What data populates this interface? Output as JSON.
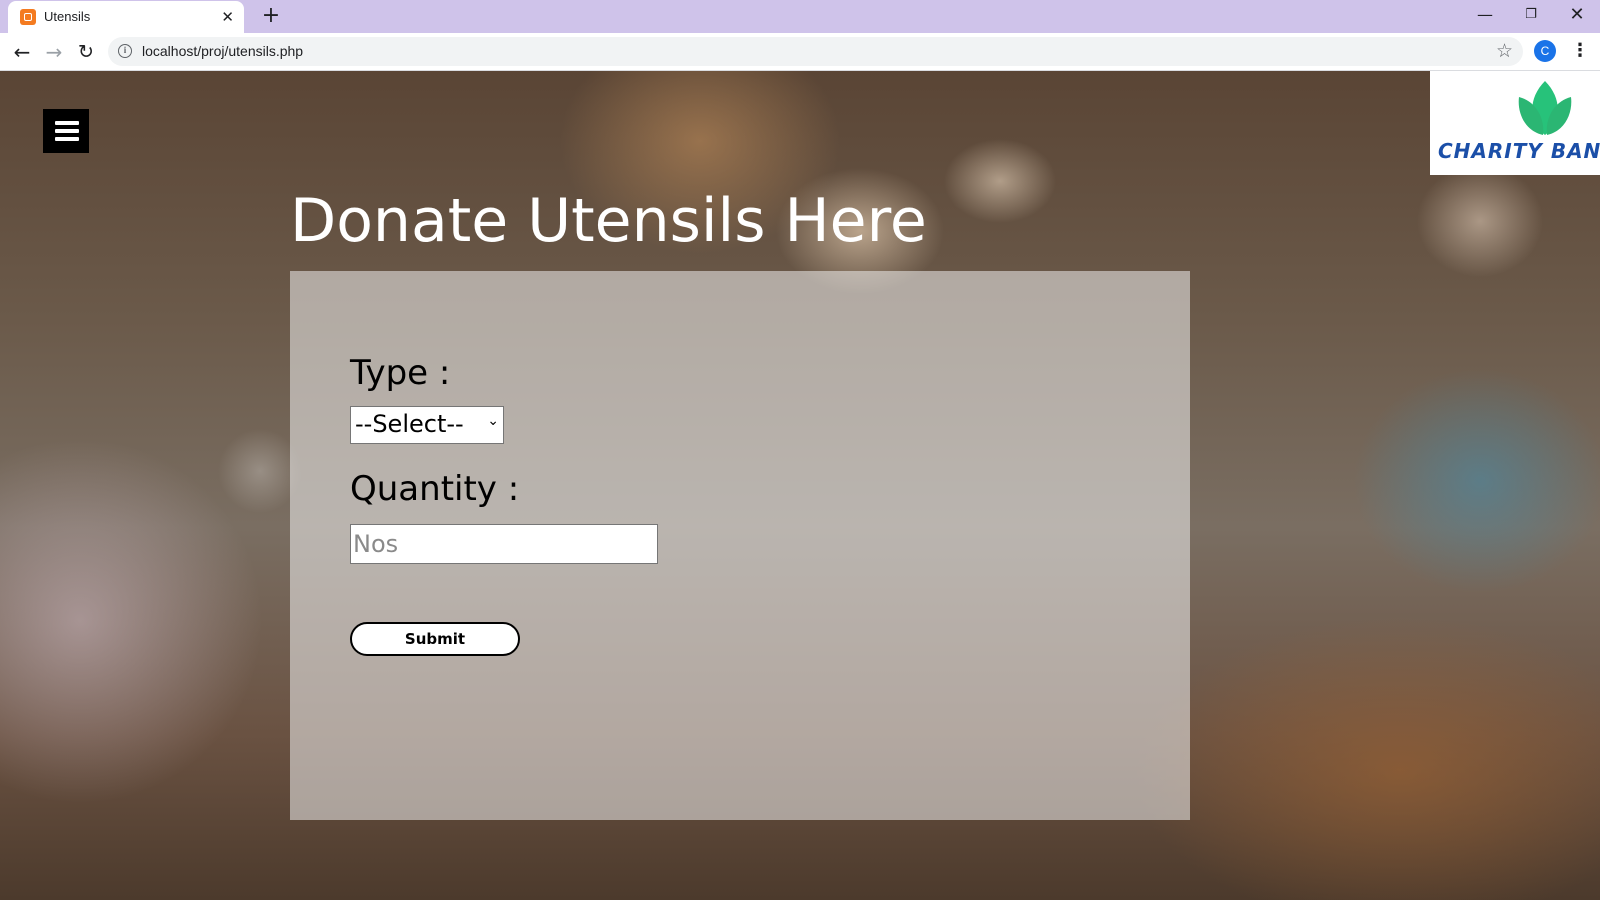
{
  "browser": {
    "tab_title": "Utensils",
    "tab_close": "✕",
    "new_tab": "+",
    "url": "localhost/proj/utensils.php",
    "profile_initial": "C",
    "window_controls": {
      "minimize": "—",
      "maximize": "❐",
      "close": "✕"
    },
    "icons": {
      "back": "arrow-left",
      "forward": "arrow-right",
      "reload": "reload",
      "info": "info",
      "star": "star",
      "menu": "kebab"
    }
  },
  "page": {
    "menu_icon": "hamburger",
    "logo_text": "CHARITY BANK",
    "heading": "Donate Utensils Here",
    "form": {
      "type_label": "Type :",
      "type_selected": "--Select--",
      "quantity_label": "Quantity :",
      "quantity_value": "",
      "quantity_placeholder": "Nos",
      "submit_label": "Submit"
    }
  },
  "colors": {
    "tabbar": "#cfc3ea",
    "logo_text": "#1b4fa8",
    "logo_leaves": "#27c27a",
    "profile": "#1a73e8"
  }
}
